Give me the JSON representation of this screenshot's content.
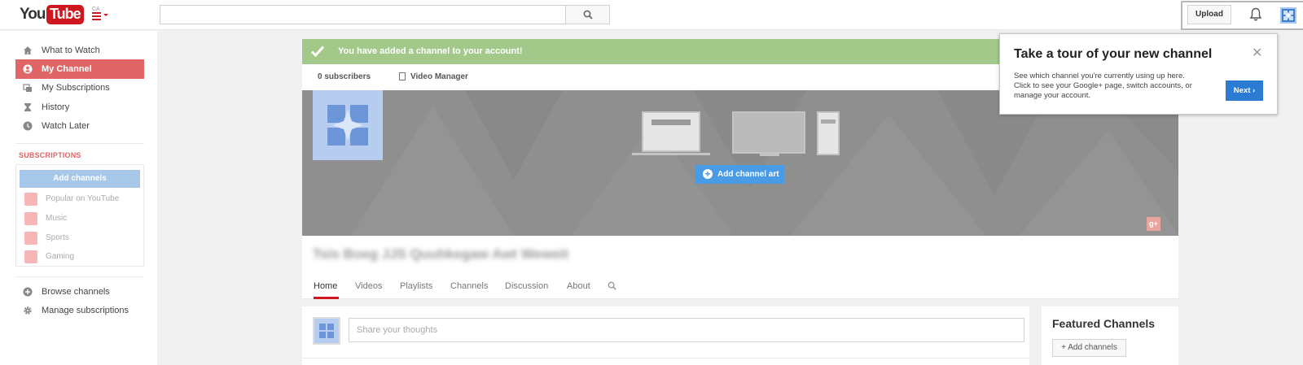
{
  "header": {
    "logo_you": "You",
    "logo_tube": "Tube",
    "logo_country": "CA",
    "search_placeholder": "",
    "upload_label": "Upload"
  },
  "sidebar": {
    "items": [
      {
        "label": "What to Watch",
        "icon": "home-icon"
      },
      {
        "label": "My Channel",
        "icon": "user-icon",
        "active": true
      },
      {
        "label": "My Subscriptions",
        "icon": "subscriptions-icon"
      },
      {
        "label": "History",
        "icon": "hourglass-icon"
      },
      {
        "label": "Watch Later",
        "icon": "clock-icon"
      }
    ],
    "subscriptions_title": "SUBSCRIPTIONS",
    "add_channels_label": "Add channels",
    "subscriptions": [
      {
        "label": "Popular on YouTube"
      },
      {
        "label": "Music"
      },
      {
        "label": "Sports"
      },
      {
        "label": "Gaming"
      }
    ],
    "bottom_items": [
      {
        "label": "Browse channels",
        "icon": "plus-circle-icon"
      },
      {
        "label": "Manage subscriptions",
        "icon": "gear-icon"
      }
    ]
  },
  "alert": {
    "text": "You have added a channel to your account!"
  },
  "channel": {
    "subscribers": "0 subscribers",
    "video_manager": "Video Manager",
    "add_art_label": "Add channel art",
    "gplus_label": "g+",
    "name": "Tsis Boeg JJS Quuhkegaw Awt Weweit",
    "tabs": [
      "Home",
      "Videos",
      "Playlists",
      "Channels",
      "Discussion",
      "About"
    ],
    "share_placeholder": "Share your thoughts",
    "featured_title": "Featured Channels",
    "add_channels_small": "+ Add channels"
  },
  "tour": {
    "title": "Take a tour of your new channel",
    "close": "✕",
    "description": "See which channel you're currently using up here. Click to see your Google+ page, switch accounts, or manage your account.",
    "next_label": "Next ›"
  },
  "colors": {
    "brand_red": "#cc181e",
    "sidebar_active": "#e06566",
    "alert_green": "#a2c98a",
    "primary_blue": "#2b7bd3"
  }
}
